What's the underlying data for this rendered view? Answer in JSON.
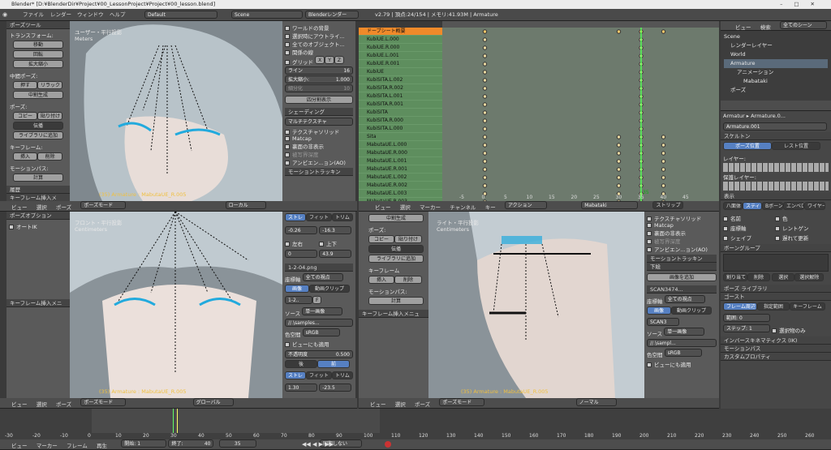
{
  "title": "Blender* [D:¥BlenderDir¥Project¥00_LessonProject¥Project¥00_lesson.blend]",
  "menu": [
    "ファイル",
    "レンダー",
    "ウィンドウ",
    "ヘルプ"
  ],
  "layout_name": "Default",
  "scene_name": "Scene",
  "render_engine": "Blenderレンダー",
  "stats": "v2.79 | 頂点:24/154 | メモリ:41.93M | Armature",
  "tl_vp": {
    "label": "ユーザー・平行投影",
    "unit": "Meters",
    "status": "(35) Armature : MabutaUE_R.005"
  },
  "bl_vp": {
    "label": "フロント・平行投影",
    "unit": "Centimeters",
    "status": "(35) Armature : MabutaUE_R.005"
  },
  "br_vp": {
    "label": "ライト・平行投影",
    "unit": "Centimeters",
    "status": "(35) Armature : MabutaUE_R.005"
  },
  "tool": {
    "header": "ポーズツール",
    "trans": "トランスフォーム:",
    "move": "移動",
    "rotate": "回転",
    "scale": "拡大縮小",
    "inbetween": "中間ポーズ:",
    "push": "押す",
    "relax": "リラック",
    "breakdowner": "中割生成",
    "pose": "ポーズ:",
    "copy": "コピー",
    "paste": "貼り付け",
    "flip": "伝播",
    "library": "ライブラリに追加",
    "keyframe": "キーフレーム:",
    "insert": "挿入",
    "delete": "削除",
    "motion_path": "モーションパス:",
    "calc": "計算",
    "history": "履歴",
    "insert_menu": "キーフレーム挿入メ"
  },
  "tool2": {
    "header": "ポーズオプション",
    "auto_ik": "オートIK",
    "insert_menu": "キーフレーム挿入メニ"
  },
  "tl_props": {
    "world_bg": "ワールドの背景",
    "outline": "選択時にアウトライ...",
    "all_obj": "全てのオブジェクト...",
    "relationship": "関係の線",
    "grid": "グリッド",
    "x": "X",
    "y": "Y",
    "z": "Z",
    "lines_l": "ライン",
    "lines_v": "16",
    "scale_l": "拡大縮小:",
    "scale_v": "1.000",
    "subdiv_l": "細分化",
    "subdiv_v": "10",
    "quad": "四分割表示",
    "shading": "シェーディング",
    "multitex": "マルチテクスチャ",
    "texsolid": "テクスチャソリッド",
    "matcap": "Matcap",
    "backface": "裏面の非表示",
    "depth": "被写界深度",
    "ao": "アンビエン...ョン(AO)",
    "motion": "モーショントラッキン"
  },
  "bl_props": {
    "stretch": "ストレ",
    "fit": "フィット",
    "trim": "トリム",
    "v1": "-0.26",
    "v2": "-16.3",
    "left": "左右",
    "up": "上下",
    "v3": "0",
    "v4": "43.9",
    "img": "1-2-04.png",
    "coord": "座標軸",
    "coord_v": "全ての視点",
    "img_b": "画像",
    "movie": "動画クリップ",
    "s1": "1-2..",
    "frame": "F",
    "src": "ソース",
    "src_v": "単一画像",
    "path": "//.\\samples...",
    "colorspace": "色空間",
    "srgb": "sRGB",
    "show": "ビューにも適用",
    "opacity": "不透明度",
    "opacity_v": "0.500",
    "front": "前",
    "back": "後",
    "stretch2": "ストレ",
    "fit2": "フィット",
    "trim2": "トリム",
    "v5": "1.30",
    "v6": "-23.5"
  },
  "bm_tool": {
    "breakdowner": "中割生成",
    "pose": "ポーズ:",
    "copy": "コピー",
    "paste": "貼り付け",
    "flip": "伝播",
    "library": "ライブラリに追加",
    "keyframe": "キーフレーム",
    "insert": "挿入",
    "delete": "削除",
    "motion_path": "モーションパス:",
    "calc": "計算",
    "insert_menu": "キーフレーム挿入メニュ"
  },
  "br_props": {
    "texsolid": "テクスチャソリッド",
    "matcap": "Matcap",
    "backface": "裏面の非表示",
    "depth": "被写界深度",
    "ao": "アンビエン...ョン(AO)",
    "motion": "モーショントラッキン",
    "bg": "下絵",
    "add": "画像を追加",
    "scan": "SCAN3474...",
    "coord": "座標軸",
    "coord_v": "全ての視点",
    "img_b": "画像",
    "movie": "動画クリップ",
    "scan2": "SCAN3",
    "src": "ソース",
    "src_v": "単一画像",
    "path": "//.\\sampl...",
    "colorspace": "色空間",
    "srgb": "sRGB",
    "show": "ビューにも適用"
  },
  "dopesheet": {
    "summary": "ドープシート概要",
    "rows": [
      "KubiUE.L.000",
      "KubiUE.R.000",
      "KubiUE.L.001",
      "KubiUE.R.001",
      "KubiUE",
      "KubiSITA.L.002",
      "KubiSITA.R.002",
      "KubiSITA.L.001",
      "KubiSITA.R.001",
      "KubiSITA",
      "KubiSITA.R.000",
      "KubiSITA.L.000",
      "Sita",
      "MabutaUE.L.000",
      "MabutaUE.R.000",
      "MabutaUE.L.001",
      "MabutaUE.R.001",
      "MabutaUE.L.002",
      "MabutaUE.R.002",
      "MabutaUE.L.003",
      "MabutaUE.R.003"
    ],
    "ticks": [
      "-5",
      "0",
      "5",
      "10",
      "15",
      "20",
      "25",
      "30",
      "35",
      "40",
      "45"
    ],
    "current": "35",
    "menu": [
      "ビュー",
      "選択",
      "マーカー",
      "チャンネル",
      "キー"
    ],
    "mode": "アクション",
    "action": "Mabataki",
    "sync": "ストリップ"
  },
  "outliner": {
    "view": "ビュー",
    "search": "検索",
    "scenes": "全てのシーン",
    "items": [
      "Scene",
      "レンダーレイヤー",
      "World",
      "Armature",
      "アニメーション",
      "Mabataki",
      "ポーズ"
    ]
  },
  "props": {
    "object": "Armatur",
    "data": "Armature.0...",
    "bone_name": "Armature.001",
    "skeleton": "スケルトン",
    "pose_pos": "ポーズ位置",
    "rest_pos": "レスト位置",
    "layer": "レイヤー:",
    "protect": "保護レイヤー:",
    "display": "表示",
    "octa": "八面体",
    "stick": "スティック",
    "bbone": "Bボーン",
    "envelope": "エンベロ",
    "wire": "ワイヤー",
    "names": "名前",
    "colors": "色",
    "axes": "座標軸",
    "xray": "レントゲン",
    "shapes": "シェイプ",
    "delay": "遅れて更新",
    "bone_group": "ボーングループ",
    "assign": "割り当て",
    "remove": "削除",
    "select": "選択",
    "deselect": "選択解除",
    "pose_lib": "ポーズ ライブラリ",
    "ghost": "ゴースト",
    "ghost_range": "フレーム周辺",
    "ghost_frame": "指定範囲",
    "ghost_key": "キーフレーム",
    "range_l": "範囲:",
    "range_v": "0",
    "step_l": "ステップ:",
    "step_v": "1",
    "selected": "選択物のみ",
    "ik": "インバースキネマティクス (IK)",
    "motionpath": "モーションパス",
    "custom": "カスタムプロパティ"
  },
  "header_bar": {
    "view": "ビュー",
    "select": "選択",
    "pose": "ポーズ",
    "mode": "ポーズモード",
    "global": "グローバル",
    "local": "ローカル",
    "normal": "ノーマル"
  },
  "timeline": {
    "ticks": [
      "-30",
      "-20",
      "-10",
      "0",
      "10",
      "20",
      "30",
      "40",
      "50",
      "60",
      "70",
      "80",
      "90",
      "100",
      "110",
      "120",
      "130",
      "140",
      "150",
      "160",
      "170",
      "180",
      "190",
      "200",
      "210",
      "220",
      "230",
      "240",
      "250",
      "260"
    ],
    "menu": [
      "ビュー",
      "マーカー",
      "フレーム",
      "再生"
    ],
    "start_l": "開始:",
    "start_v": "1",
    "end_l": "終了:",
    "end_v": "40",
    "cur": "35",
    "sync": "同期しない"
  }
}
